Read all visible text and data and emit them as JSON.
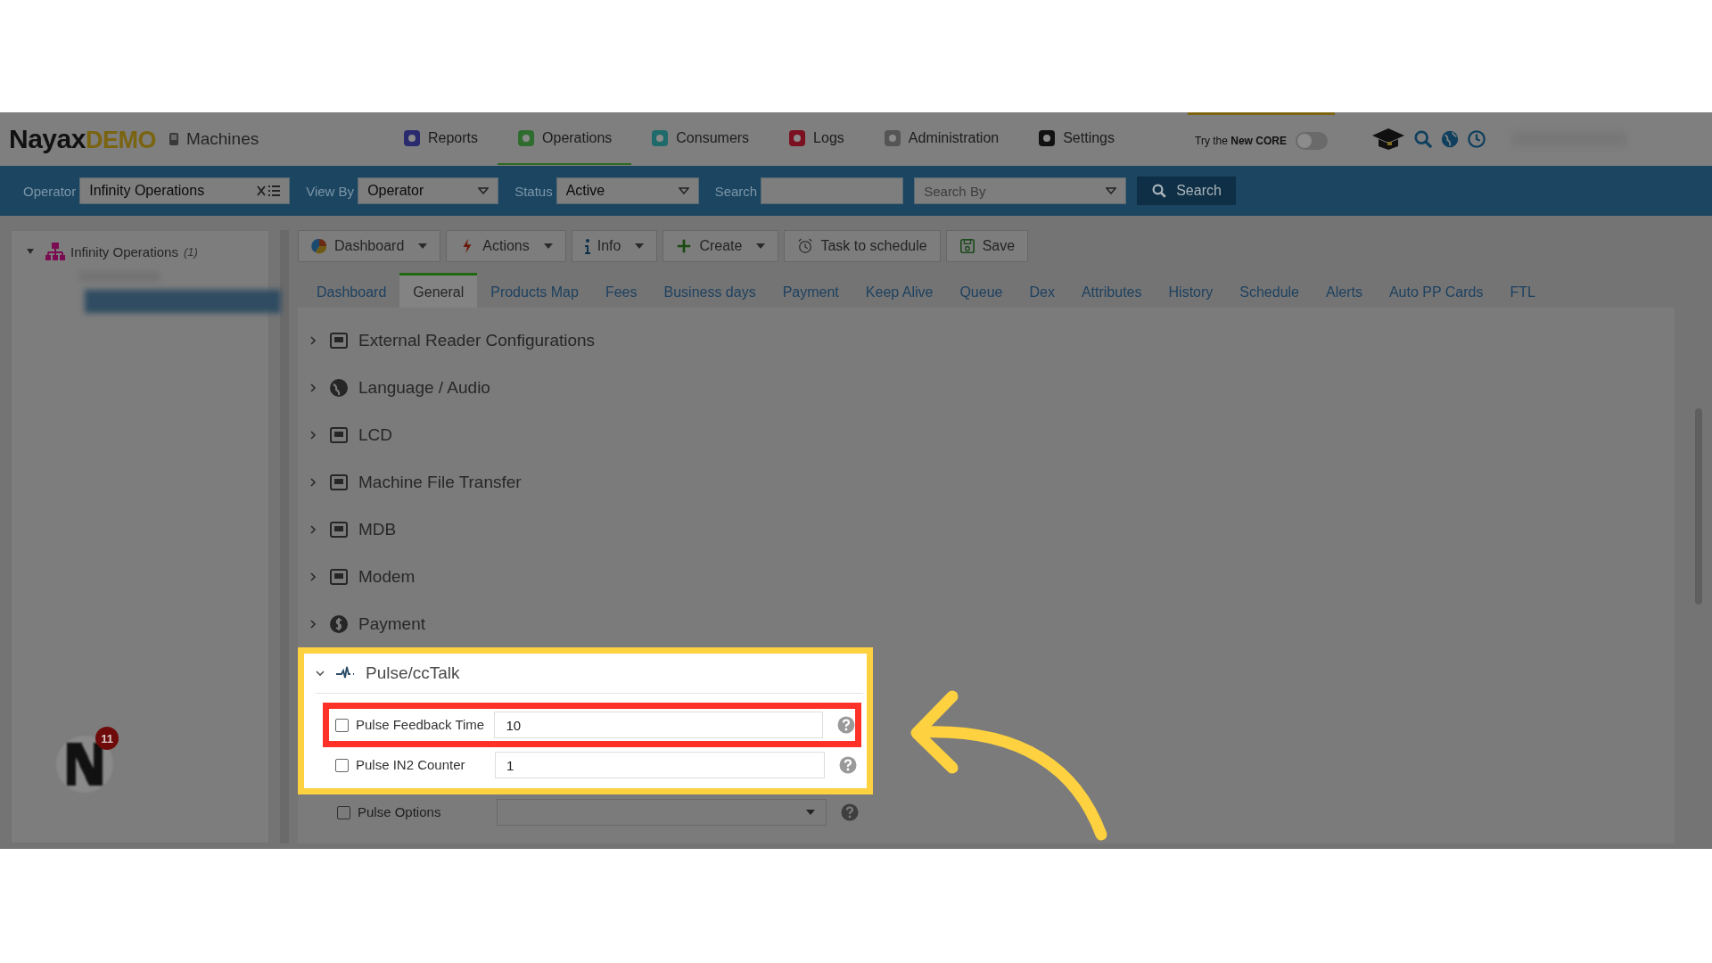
{
  "header": {
    "brand": "Nayax",
    "brand_suffix": "DEMO",
    "product": "Machines",
    "nav": [
      {
        "label": "Reports",
        "selected": false
      },
      {
        "label": "Operations",
        "selected": true
      },
      {
        "label": "Consumers",
        "selected": false
      },
      {
        "label": "Logs",
        "selected": false
      },
      {
        "label": "Administration",
        "selected": false
      },
      {
        "label": "Settings",
        "selected": false
      }
    ],
    "promo": {
      "text": "Try the **New CORE**",
      "on": false
    }
  },
  "filters": {
    "operator": {
      "label": "Operator",
      "value": "Infinity Operations"
    },
    "view_by": {
      "label": "View By",
      "value": "Operator"
    },
    "status": {
      "label": "Status",
      "value": "Active"
    },
    "search": {
      "label": "Search"
    },
    "search_by": {
      "placeholder": "Search By"
    },
    "search_button": "Search"
  },
  "sidebar": {
    "tree": [
      {
        "label": "Infinity Operations",
        "count": "(1)",
        "expanded": true
      }
    ],
    "notification_count": "11"
  },
  "toolbar": [
    {
      "label": "Dashboard",
      "kind": "dropdown"
    },
    {
      "label": "Actions",
      "kind": "dropdown"
    },
    {
      "label": "Info",
      "kind": "dropdown"
    },
    {
      "label": "Create",
      "kind": "dropdown"
    },
    {
      "label": "Task to schedule",
      "kind": "button"
    },
    {
      "label": "Save",
      "kind": "button"
    }
  ],
  "tabs": [
    {
      "label": "Dashboard",
      "selected": false
    },
    {
      "label": "General",
      "selected": true
    },
    {
      "label": "Products Map",
      "selected": false
    },
    {
      "label": "Fees",
      "selected": false
    },
    {
      "label": "Business days",
      "selected": false
    },
    {
      "label": "Payment",
      "selected": false
    },
    {
      "label": "Keep Alive",
      "selected": false
    },
    {
      "label": "Queue",
      "selected": false
    },
    {
      "label": "Dex",
      "selected": false
    },
    {
      "label": "Attributes",
      "selected": false
    },
    {
      "label": "History",
      "selected": false
    },
    {
      "label": "Schedule",
      "selected": false
    },
    {
      "label": "Alerts",
      "selected": false
    },
    {
      "label": "Auto PP Cards",
      "selected": false
    },
    {
      "label": "FTL",
      "selected": false
    }
  ],
  "sections": [
    {
      "title": "External Reader Configurations",
      "expanded": false,
      "spotlight": false
    },
    {
      "title": "Language / Audio",
      "expanded": false,
      "spotlight": false
    },
    {
      "title": "LCD",
      "expanded": false,
      "spotlight": false
    },
    {
      "title": "Machine File Transfer",
      "expanded": false,
      "spotlight": false
    },
    {
      "title": "MDB",
      "expanded": false,
      "spotlight": false
    },
    {
      "title": "Modem",
      "expanded": false,
      "spotlight": false
    },
    {
      "title": "Payment",
      "expanded": false,
      "spotlight": false
    },
    {
      "title": "Pulse/ccTalk",
      "expanded": true,
      "spotlight": true,
      "fields": [
        {
          "label": "Pulse Feedback Time",
          "kind": "text",
          "checked": false,
          "value": "10",
          "spotlight": true,
          "marked": true
        },
        {
          "label": "Pulse IN2 Counter",
          "kind": "text",
          "checked": false,
          "value": "1",
          "spotlight": true,
          "marked": false
        },
        {
          "label": "Pulse Options",
          "kind": "select",
          "checked": false,
          "spotlight": false,
          "marked": false
        }
      ]
    }
  ]
}
